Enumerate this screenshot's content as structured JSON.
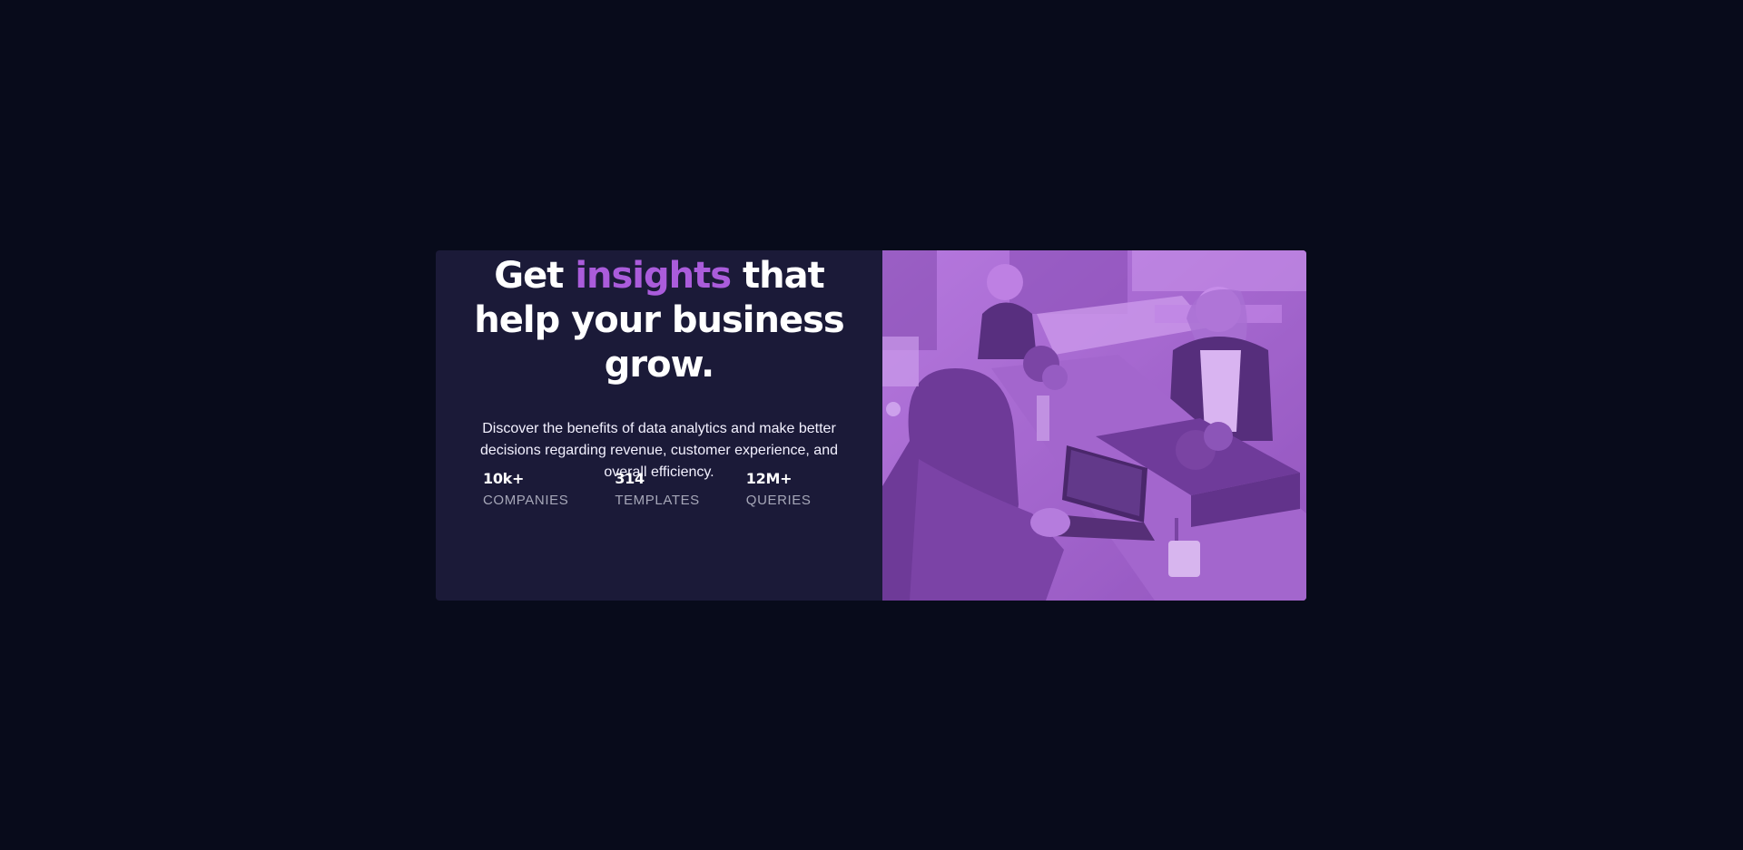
{
  "hero": {
    "headline_before": "Get ",
    "headline_accent": "insights",
    "headline_after": " that help your business grow.",
    "description": "Discover the benefits of data analytics and make better decisions regarding revenue, customer experience, and overall efficiency."
  },
  "stats": [
    {
      "value": "10k+",
      "label": "COMPANIES"
    },
    {
      "value": "314",
      "label": "TEMPLATES"
    },
    {
      "value": "12M+",
      "label": "QUERIES"
    }
  ],
  "image": {
    "subject": "team-working-in-office",
    "overlay_color": "#aa5cdb"
  },
  "colors": {
    "page_background": "#080b1b",
    "card_background": "#1b1a38",
    "accent": "#aa5cdb",
    "label_gray": "#a6a7b8"
  }
}
